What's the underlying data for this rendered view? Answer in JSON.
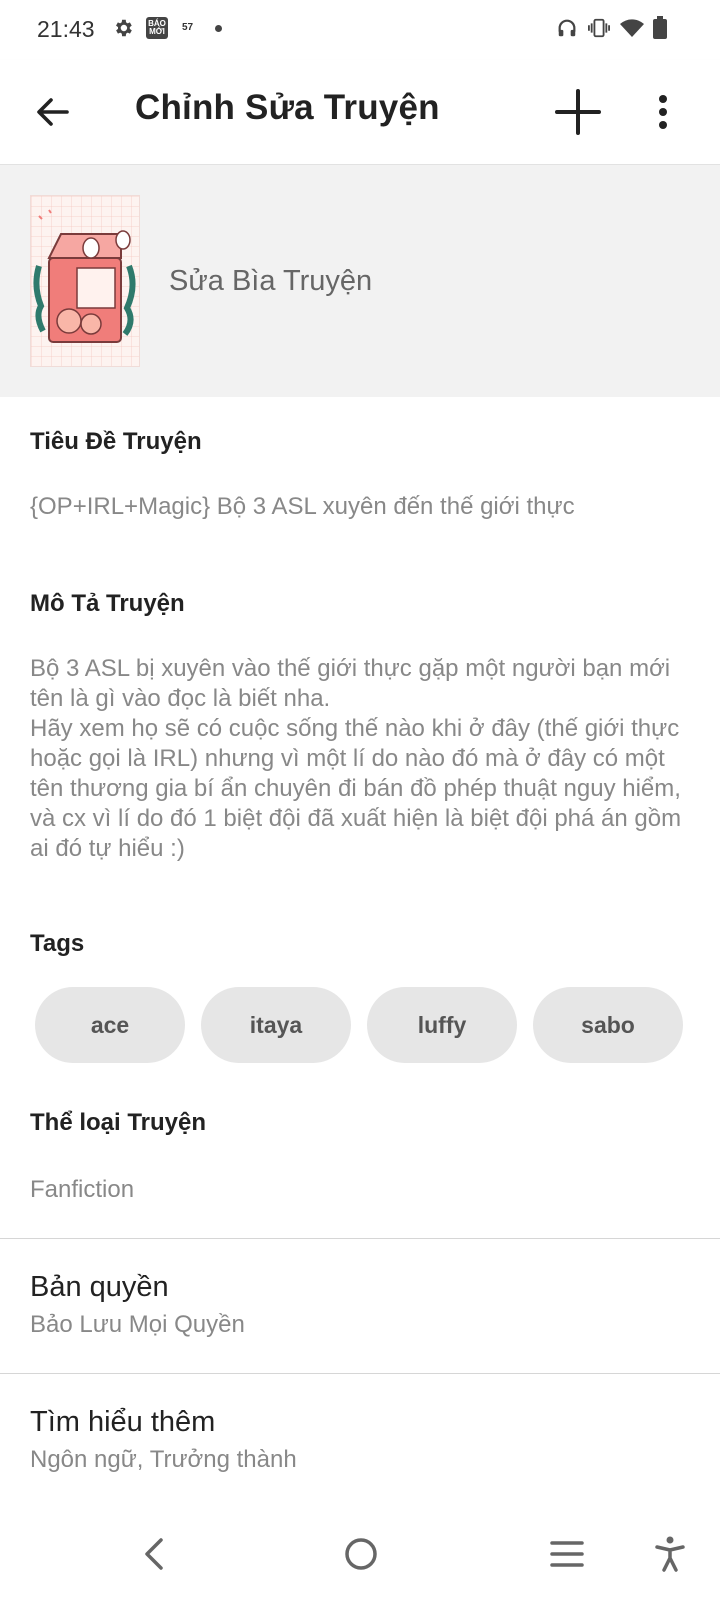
{
  "status_bar": {
    "time": "21:43",
    "badge_app": "BÁO MỚI",
    "network_speed": "57",
    "icons": [
      "gear-icon",
      "baomoi-icon",
      "speed-icon",
      "dot-icon",
      "headphones-icon",
      "vibrate-icon",
      "wifi-icon",
      "battery-icon"
    ]
  },
  "appbar": {
    "title": "Chỉnh Sửa Truyện",
    "icons": [
      "back-arrow-icon",
      "plus-icon",
      "more-vert-icon"
    ]
  },
  "cover": {
    "label": "Sửa Bìa Truyện"
  },
  "title_section": {
    "heading": "Tiêu Đề Truyện",
    "value": "{OP+IRL+Magic} Bộ 3 ASL xuyên đến thế giới thực"
  },
  "description_section": {
    "heading": "Mô Tả Truyện",
    "value": "Bộ 3 ASL bị xuyên vào thế giới thực gặp một người bạn mới tên là gì vào đọc là biết nha.\nHãy xem họ sẽ có cuộc sống thế nào khi ở đây (thế giới thực hoặc gọi là IRL) nhưng vì một lí do nào đó mà ở đây có một tên thương gia bí ẩn chuyên đi bán đồ phép thuật nguy hiểm, và cx vì lí do đó 1 biệt đội đã xuất hiện là biệt đội phá án gồm ai đó tự hiểu :)"
  },
  "tags_section": {
    "heading": "Tags",
    "tags": [
      "ace",
      "itaya",
      "luffy",
      "sabo"
    ]
  },
  "category_section": {
    "heading": "Thể loại Truyện",
    "value": "Fanfiction"
  },
  "copyright_item": {
    "title": "Bản quyền",
    "subtitle": "Bảo Lưu Mọi Quyền"
  },
  "more_item": {
    "title": "Tìm hiểu thêm",
    "subtitle": "Ngôn ngữ, Trưởng thành"
  },
  "nav_bar": {
    "icons": [
      "nav-back-icon",
      "nav-home-icon",
      "nav-recents-icon",
      "accessibility-icon"
    ]
  },
  "colors": {
    "chip_background": "#e6e6e6",
    "cover_row_background": "#f2f2f2"
  }
}
